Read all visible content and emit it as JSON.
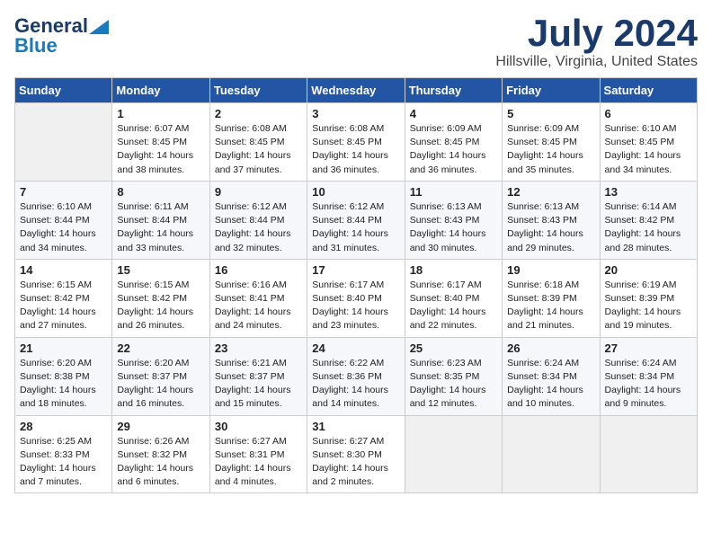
{
  "header": {
    "logo_general": "General",
    "logo_blue": "Blue",
    "month_title": "July 2024",
    "location": "Hillsville, Virginia, United States"
  },
  "days_of_week": [
    "Sunday",
    "Monday",
    "Tuesday",
    "Wednesday",
    "Thursday",
    "Friday",
    "Saturday"
  ],
  "weeks": [
    [
      {
        "num": "",
        "empty": true
      },
      {
        "num": "1",
        "sunrise": "6:07 AM",
        "sunset": "8:45 PM",
        "daylight": "14 hours and 38 minutes."
      },
      {
        "num": "2",
        "sunrise": "6:08 AM",
        "sunset": "8:45 PM",
        "daylight": "14 hours and 37 minutes."
      },
      {
        "num": "3",
        "sunrise": "6:08 AM",
        "sunset": "8:45 PM",
        "daylight": "14 hours and 36 minutes."
      },
      {
        "num": "4",
        "sunrise": "6:09 AM",
        "sunset": "8:45 PM",
        "daylight": "14 hours and 36 minutes."
      },
      {
        "num": "5",
        "sunrise": "6:09 AM",
        "sunset": "8:45 PM",
        "daylight": "14 hours and 35 minutes."
      },
      {
        "num": "6",
        "sunrise": "6:10 AM",
        "sunset": "8:45 PM",
        "daylight": "14 hours and 34 minutes."
      }
    ],
    [
      {
        "num": "7",
        "sunrise": "6:10 AM",
        "sunset": "8:44 PM",
        "daylight": "14 hours and 34 minutes."
      },
      {
        "num": "8",
        "sunrise": "6:11 AM",
        "sunset": "8:44 PM",
        "daylight": "14 hours and 33 minutes."
      },
      {
        "num": "9",
        "sunrise": "6:12 AM",
        "sunset": "8:44 PM",
        "daylight": "14 hours and 32 minutes."
      },
      {
        "num": "10",
        "sunrise": "6:12 AM",
        "sunset": "8:44 PM",
        "daylight": "14 hours and 31 minutes."
      },
      {
        "num": "11",
        "sunrise": "6:13 AM",
        "sunset": "8:43 PM",
        "daylight": "14 hours and 30 minutes."
      },
      {
        "num": "12",
        "sunrise": "6:13 AM",
        "sunset": "8:43 PM",
        "daylight": "14 hours and 29 minutes."
      },
      {
        "num": "13",
        "sunrise": "6:14 AM",
        "sunset": "8:42 PM",
        "daylight": "14 hours and 28 minutes."
      }
    ],
    [
      {
        "num": "14",
        "sunrise": "6:15 AM",
        "sunset": "8:42 PM",
        "daylight": "14 hours and 27 minutes."
      },
      {
        "num": "15",
        "sunrise": "6:15 AM",
        "sunset": "8:42 PM",
        "daylight": "14 hours and 26 minutes."
      },
      {
        "num": "16",
        "sunrise": "6:16 AM",
        "sunset": "8:41 PM",
        "daylight": "14 hours and 24 minutes."
      },
      {
        "num": "17",
        "sunrise": "6:17 AM",
        "sunset": "8:40 PM",
        "daylight": "14 hours and 23 minutes."
      },
      {
        "num": "18",
        "sunrise": "6:17 AM",
        "sunset": "8:40 PM",
        "daylight": "14 hours and 22 minutes."
      },
      {
        "num": "19",
        "sunrise": "6:18 AM",
        "sunset": "8:39 PM",
        "daylight": "14 hours and 21 minutes."
      },
      {
        "num": "20",
        "sunrise": "6:19 AM",
        "sunset": "8:39 PM",
        "daylight": "14 hours and 19 minutes."
      }
    ],
    [
      {
        "num": "21",
        "sunrise": "6:20 AM",
        "sunset": "8:38 PM",
        "daylight": "14 hours and 18 minutes."
      },
      {
        "num": "22",
        "sunrise": "6:20 AM",
        "sunset": "8:37 PM",
        "daylight": "14 hours and 16 minutes."
      },
      {
        "num": "23",
        "sunrise": "6:21 AM",
        "sunset": "8:37 PM",
        "daylight": "14 hours and 15 minutes."
      },
      {
        "num": "24",
        "sunrise": "6:22 AM",
        "sunset": "8:36 PM",
        "daylight": "14 hours and 14 minutes."
      },
      {
        "num": "25",
        "sunrise": "6:23 AM",
        "sunset": "8:35 PM",
        "daylight": "14 hours and 12 minutes."
      },
      {
        "num": "26",
        "sunrise": "6:24 AM",
        "sunset": "8:34 PM",
        "daylight": "14 hours and 10 minutes."
      },
      {
        "num": "27",
        "sunrise": "6:24 AM",
        "sunset": "8:34 PM",
        "daylight": "14 hours and 9 minutes."
      }
    ],
    [
      {
        "num": "28",
        "sunrise": "6:25 AM",
        "sunset": "8:33 PM",
        "daylight": "14 hours and 7 minutes."
      },
      {
        "num": "29",
        "sunrise": "6:26 AM",
        "sunset": "8:32 PM",
        "daylight": "14 hours and 6 minutes."
      },
      {
        "num": "30",
        "sunrise": "6:27 AM",
        "sunset": "8:31 PM",
        "daylight": "14 hours and 4 minutes."
      },
      {
        "num": "31",
        "sunrise": "6:27 AM",
        "sunset": "8:30 PM",
        "daylight": "14 hours and 2 minutes."
      },
      {
        "num": "",
        "empty": true
      },
      {
        "num": "",
        "empty": true
      },
      {
        "num": "",
        "empty": true
      }
    ]
  ],
  "labels": {
    "sunrise": "Sunrise:",
    "sunset": "Sunset:",
    "daylight": "Daylight:"
  }
}
